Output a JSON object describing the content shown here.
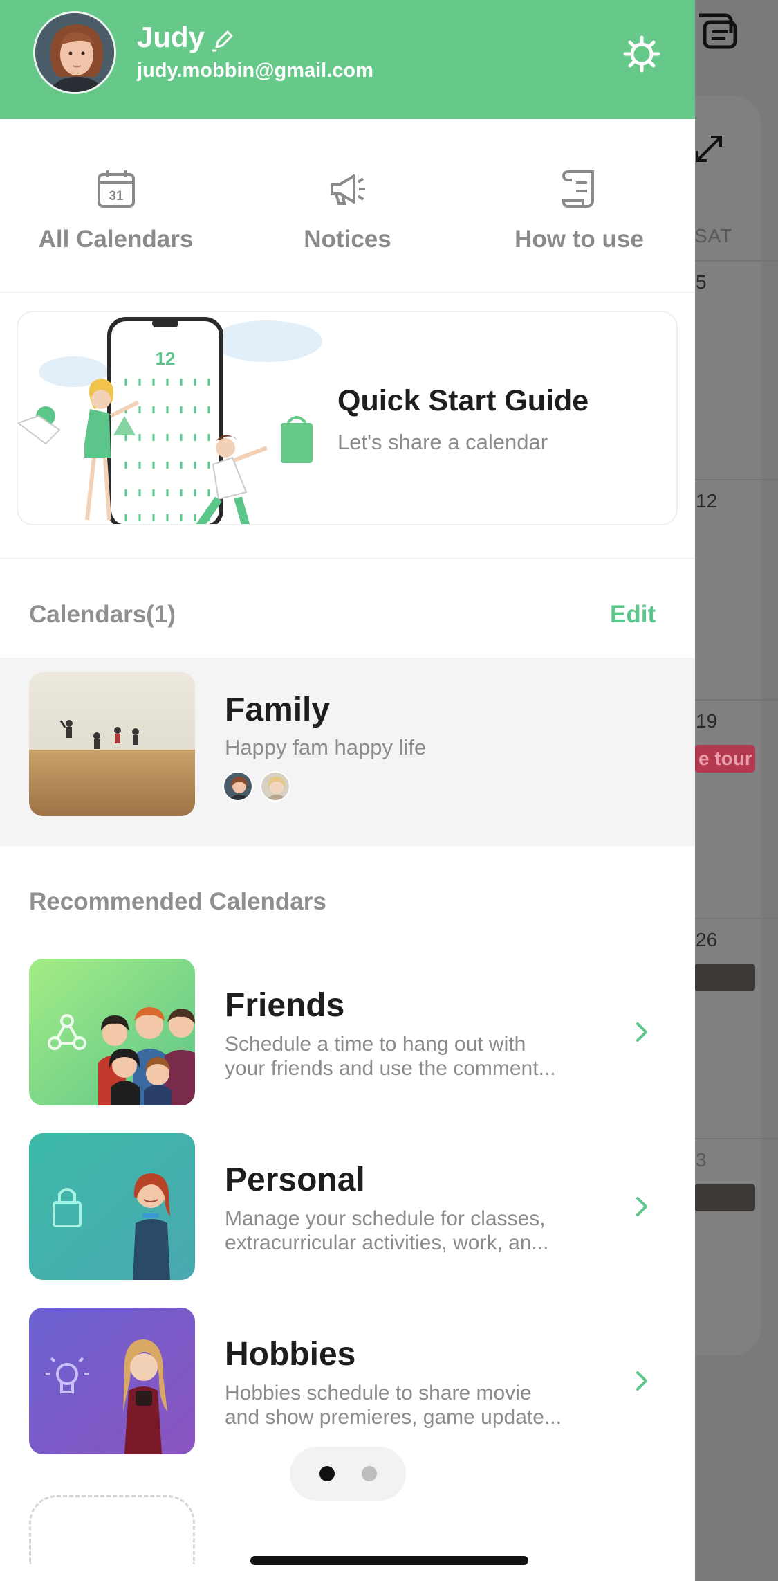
{
  "colors": {
    "brand_green": "#66c98a",
    "accent_green": "#5cc589",
    "text_dark": "#1e1e1e",
    "text_gray": "#8c8c8c",
    "row_highlight": "#f4f4f4"
  },
  "profile": {
    "name": "Judy",
    "email": "judy.mobbin@gmail.com",
    "avatar_icon": "user-avatar",
    "edit_icon": "pencil-icon",
    "settings_icon": "gear-icon"
  },
  "quick_tabs": [
    {
      "label": "All Calendars",
      "icon": "calendar-icon",
      "day": "31"
    },
    {
      "label": "Notices",
      "icon": "megaphone-icon"
    },
    {
      "label": "How to use",
      "icon": "scroll-icon"
    }
  ],
  "guide": {
    "title": "Quick Start Guide",
    "subtitle": "Let's share a calendar",
    "phone_number": "12"
  },
  "calendars": {
    "heading": "Calendars(1)",
    "edit_label": "Edit",
    "items": [
      {
        "title": "Family",
        "subtitle": "Happy fam happy life",
        "members": 2
      }
    ]
  },
  "recommended": {
    "heading": "Recommended Calendars",
    "items": [
      {
        "title": "Friends",
        "line1": "Schedule a time to hang out with",
        "line2": "your friends and use the comment...",
        "icon": "share-nodes-icon"
      },
      {
        "title": "Personal",
        "line1": "Manage your schedule for classes,",
        "line2": "extracurricular activities, work, an...",
        "icon": "lock-icon"
      },
      {
        "title": "Hobbies",
        "line1": "Hobbies schedule to share movie",
        "line2": "and show premieres, game update...",
        "icon": "lightbulb-icon"
      }
    ]
  },
  "pager": {
    "pages": 2,
    "current": 1
  },
  "background_calendar": {
    "day_header": "SAT",
    "dates": [
      "5",
      "12",
      "19",
      "26",
      "3"
    ],
    "event_label": "e tour"
  }
}
